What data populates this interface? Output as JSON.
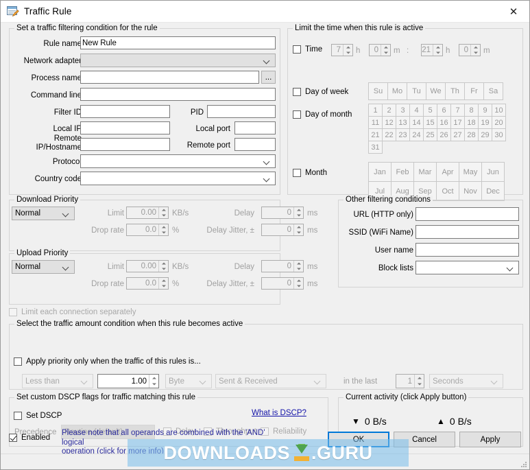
{
  "window": {
    "title": "Traffic Rule",
    "icon": "rule-edit-icon",
    "close_label": "✕"
  },
  "filter_group": {
    "caption": "Set a traffic filtering condition for the rule",
    "labels": {
      "rule_name": "Rule name",
      "network_adapter": "Network adapter",
      "process_name": "Process name",
      "command_line": "Command line",
      "filter_id": "Filter ID",
      "pid": "PID",
      "local_ip": "Local IP",
      "local_port": "Local port",
      "remote_ip": "Remote IP/Hostname",
      "remote_ip_line1": "Remote",
      "remote_ip_line2": "IP/Hostname",
      "remote_port": "Remote port",
      "protocol": "Protocol",
      "country_code": "Country code"
    },
    "values": {
      "rule_name": "New Rule",
      "network_adapter": "",
      "process_name": "",
      "command_line": "",
      "filter_id": "",
      "pid": "",
      "local_ip": "",
      "local_port": "",
      "remote_ip": "",
      "remote_port": "",
      "protocol": "",
      "country_code": ""
    },
    "browse_button": "..."
  },
  "time_group": {
    "caption": "Limit the time when this rule is active",
    "time": {
      "label": "Time",
      "checked": false,
      "from_h": "7",
      "from_m": "0",
      "to_h": "21",
      "to_m": "0",
      "unit_h": "h",
      "unit_m": "m",
      "separator": ":"
    },
    "day_of_week": {
      "label": "Day of week",
      "checked": false,
      "days": [
        "Su",
        "Mo",
        "Tu",
        "We",
        "Th",
        "Fr",
        "Sa"
      ]
    },
    "day_of_month": {
      "label": "Day of month",
      "checked": false,
      "days": [
        "1",
        "2",
        "3",
        "4",
        "5",
        "6",
        "7",
        "8",
        "9",
        "10",
        "11",
        "12",
        "13",
        "14",
        "15",
        "16",
        "17",
        "18",
        "19",
        "20",
        "21",
        "22",
        "23",
        "24",
        "25",
        "26",
        "27",
        "28",
        "29",
        "30",
        "31"
      ]
    },
    "month": {
      "label": "Month",
      "checked": false,
      "months": [
        "Jan",
        "Feb",
        "Mar",
        "Apr",
        "May",
        "Jun",
        "Jul",
        "Aug",
        "Sep",
        "Oct",
        "Nov",
        "Dec"
      ]
    }
  },
  "download_group": {
    "caption": "Download Priority",
    "priority": "Normal",
    "limit_label": "Limit",
    "limit_value": "0.00",
    "limit_unit": "KB/s",
    "drop_label": "Drop rate",
    "drop_value": "0.0",
    "drop_unit": "%",
    "delay_label": "Delay",
    "delay_value": "0",
    "delay_unit": "ms",
    "jitter_label": "Delay Jitter, ±",
    "jitter_value": "0",
    "jitter_unit": "ms"
  },
  "upload_group": {
    "caption": "Upload Priority",
    "priority": "Normal",
    "limit_label": "Limit",
    "limit_value": "0.00",
    "limit_unit": "KB/s",
    "drop_label": "Drop rate",
    "drop_value": "0.0",
    "drop_unit": "%",
    "delay_label": "Delay",
    "delay_value": "0",
    "delay_unit": "ms",
    "jitter_label": "Delay Jitter, ±",
    "jitter_value": "0",
    "jitter_unit": "ms"
  },
  "limit_each_connection": {
    "label": "Limit each connection separately",
    "checked": false,
    "enabled": false
  },
  "other_group": {
    "caption": "Other filtering conditions",
    "url_label": "URL (HTTP only)",
    "url_value": "",
    "ssid_label": "SSID (WiFi Name)",
    "ssid_value": "",
    "user_label": "User name",
    "user_value": "",
    "block_label": "Block lists",
    "block_value": ""
  },
  "amount_group": {
    "caption": "Select the traffic amount condition when this rule becomes active",
    "apply_label": "Apply priority only when the traffic of this rules is...",
    "apply_checked": false,
    "comparison": "Less than",
    "amount": "1.00",
    "unit": "Byte",
    "direction": "Sent & Received",
    "in_the_last_label": "in the last",
    "period_value": "1",
    "period_unit": "Seconds"
  },
  "dscp_group": {
    "caption": "Set custom DSCP flags for traffic matching this rule",
    "set_dscp_label": "Set DSCP",
    "set_dscp_checked": false,
    "what_is_dscp": "What is DSCP?",
    "precedence_label": "Precedence",
    "precedence_value": "Routine (default)",
    "delay_label": "Delay",
    "throughput_label": "Throughput",
    "reliability_label": "Reliability"
  },
  "activity_group": {
    "caption": "Current activity (click Apply button)",
    "download_arrow": "▼",
    "download_value": "0 B/s",
    "upload_arrow": "▲",
    "upload_value": "0 B/s"
  },
  "footer": {
    "enabled_label": "Enabled",
    "enabled_checked": true,
    "note_line1": "Please note that all operands are combined with the 'AND' logical",
    "note_line2": "operation (click for more info)",
    "ok": "OK",
    "cancel": "Cancel",
    "apply": "Apply"
  },
  "watermark": {
    "text_left": "DOWNLOADS",
    "text_right": ".GURU"
  },
  "colors": {
    "accent": "#0078d7",
    "link": "#1212a8",
    "note": "#2b2b9c",
    "watermark_bg": "#78beeb"
  }
}
